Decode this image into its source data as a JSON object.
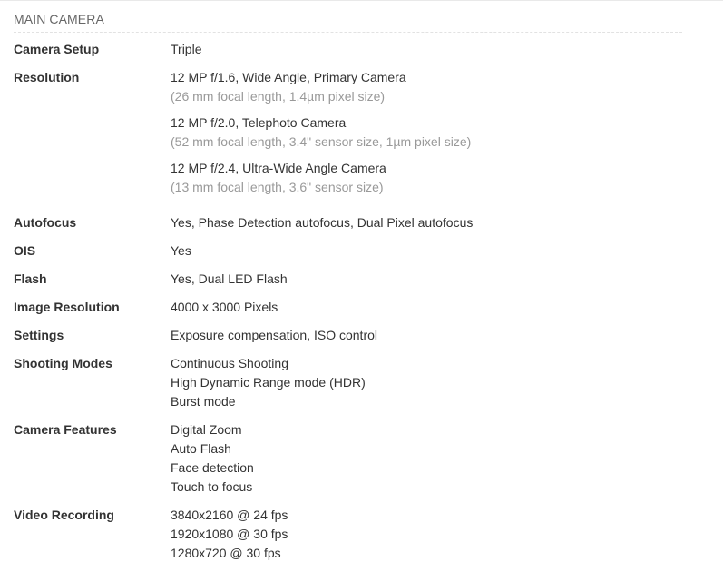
{
  "section": {
    "title": "MAIN CAMERA"
  },
  "specs": {
    "camera_setup": {
      "label": "Camera Setup",
      "value": "Triple"
    },
    "resolution": {
      "label": "Resolution",
      "cameras": [
        {
          "main": "12 MP f/1.6, Wide Angle, Primary Camera",
          "detail": "(26 mm focal length, 1.4µm pixel size)"
        },
        {
          "main": "12 MP f/2.0, Telephoto Camera",
          "detail": "(52 mm focal length, 3.4\" sensor size, 1µm pixel size)"
        },
        {
          "main": "12 MP f/2.4, Ultra-Wide Angle Camera",
          "detail": "(13 mm focal length, 3.6\" sensor size)"
        }
      ]
    },
    "autofocus": {
      "label": "Autofocus",
      "value": "Yes, Phase Detection autofocus, Dual Pixel autofocus"
    },
    "ois": {
      "label": "OIS",
      "value": "Yes"
    },
    "flash": {
      "label": "Flash",
      "value": "Yes, Dual LED Flash"
    },
    "image_resolution": {
      "label": "Image Resolution",
      "value": "4000 x 3000 Pixels"
    },
    "settings": {
      "label": "Settings",
      "value": "Exposure compensation, ISO control"
    },
    "shooting_modes": {
      "label": "Shooting Modes",
      "values": [
        "Continuous Shooting",
        "High Dynamic Range mode (HDR)",
        "Burst mode"
      ]
    },
    "camera_features": {
      "label": "Camera Features",
      "values": [
        "Digital Zoom",
        "Auto Flash",
        "Face detection",
        "Touch to focus"
      ]
    },
    "video_recording": {
      "label": "Video Recording",
      "values": [
        "3840x2160 @ 24 fps",
        "1920x1080 @ 30 fps",
        "1280x720 @ 30 fps"
      ]
    }
  }
}
